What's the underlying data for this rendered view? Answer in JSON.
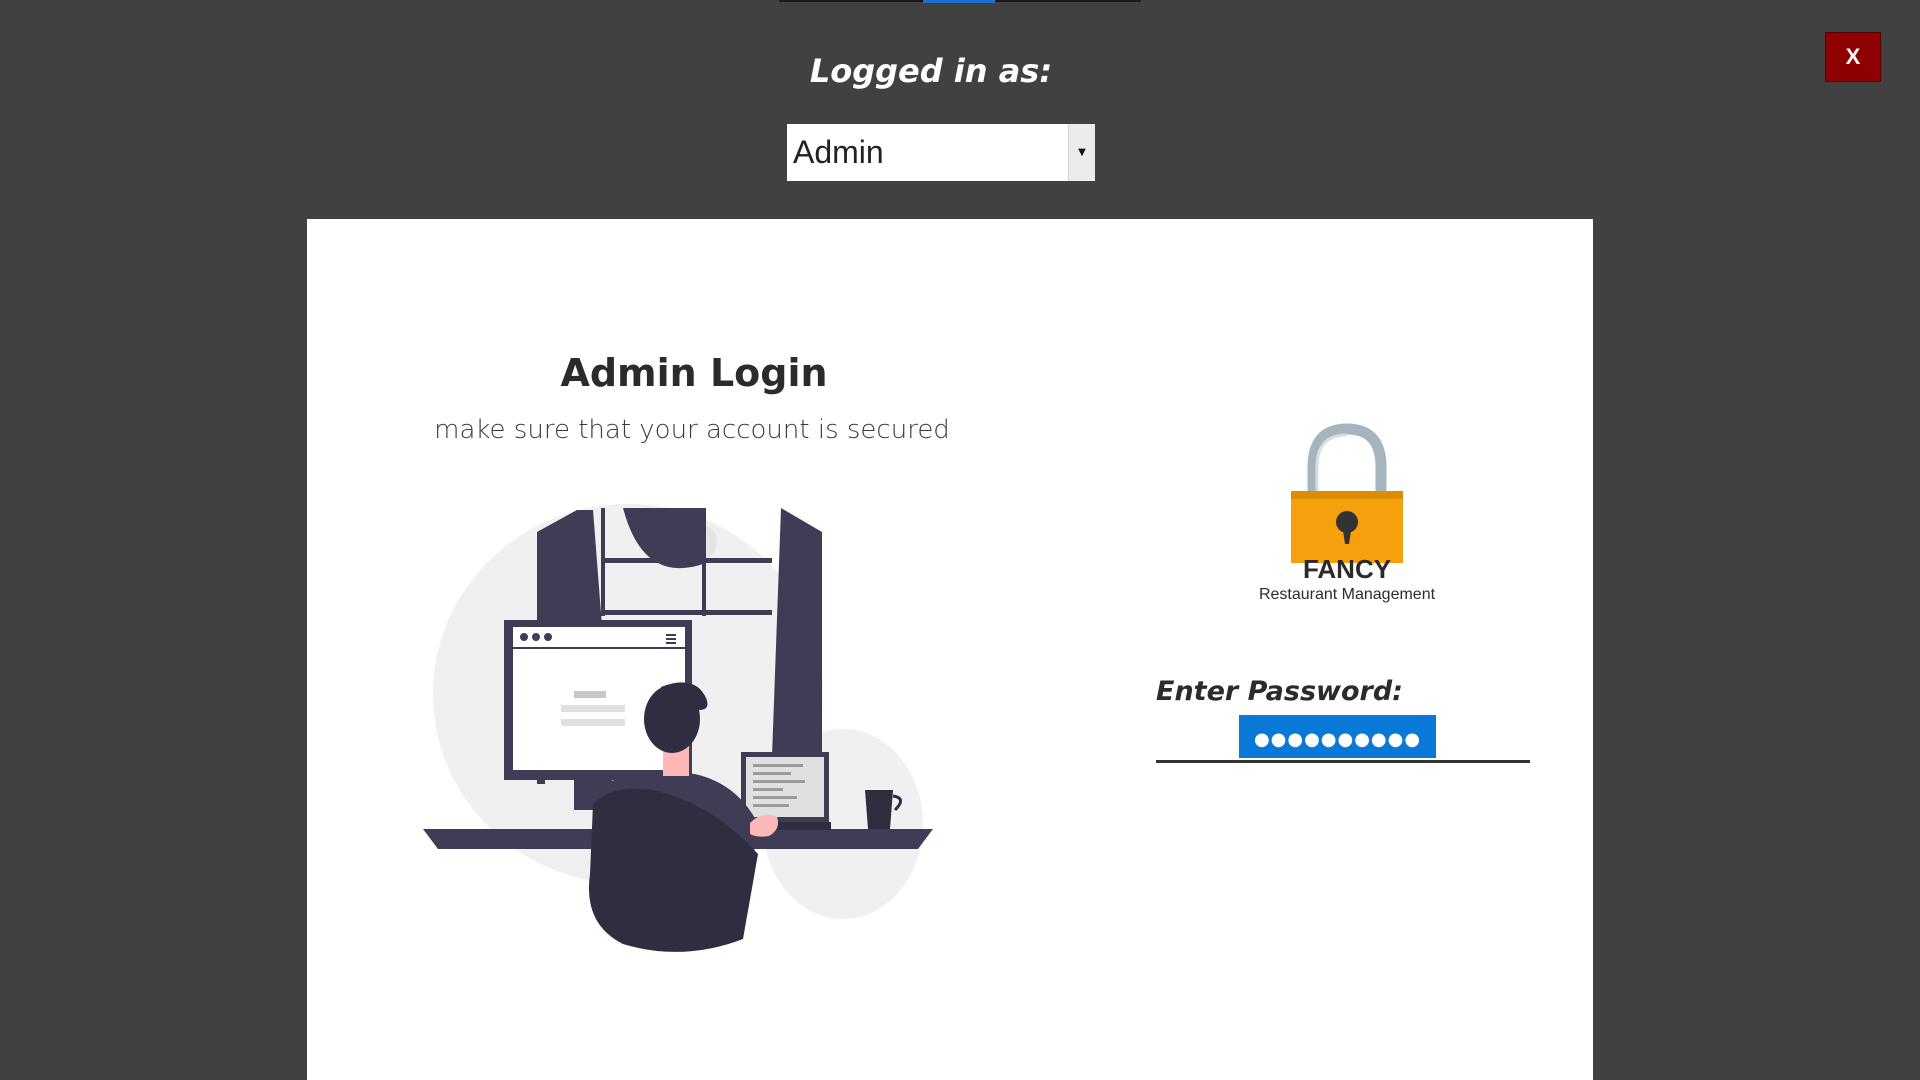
{
  "header": {
    "logged_in_label": "Logged in as:",
    "role_selected": "Admin",
    "close_label": "X"
  },
  "login": {
    "title": "Admin Login",
    "subtitle": "make sure that your account is secured"
  },
  "brand": {
    "name": "FANCY",
    "tagline": "Restaurant Management"
  },
  "password": {
    "label": "Enter Password:",
    "masked_value": "●●●●●●●●●●"
  },
  "colors": {
    "background": "#414141",
    "panel": "#ffffff",
    "close_button": "#8f0000",
    "selection": "#0a78d7",
    "lock_body": "#f5a00c"
  },
  "icons": {
    "lock": "padlock-icon",
    "dropdown": "chevron-down-icon"
  }
}
